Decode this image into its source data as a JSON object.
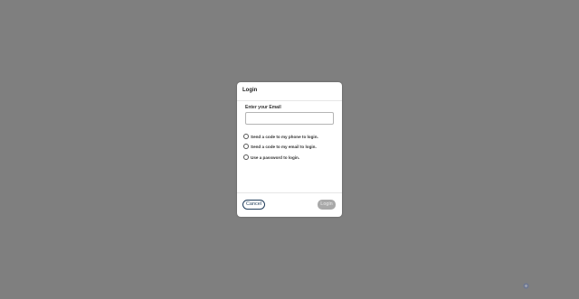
{
  "dialog": {
    "title": "Login",
    "email_label": "Enter your Email",
    "email_value": "",
    "options": [
      {
        "label": "Send a code to my phone to login.",
        "selected": false
      },
      {
        "label": "Send a code to my email to login.",
        "selected": false
      },
      {
        "label": "Use a password to login.",
        "selected": false
      }
    ],
    "cancel_label": "Cancel",
    "login_label": "Login"
  },
  "colors": {
    "backdrop": "#7f7f7f",
    "accent": "#1f3c5a",
    "disabled_button": "#a9a9a9"
  },
  "icons": {
    "watermark": "logo-icon"
  }
}
